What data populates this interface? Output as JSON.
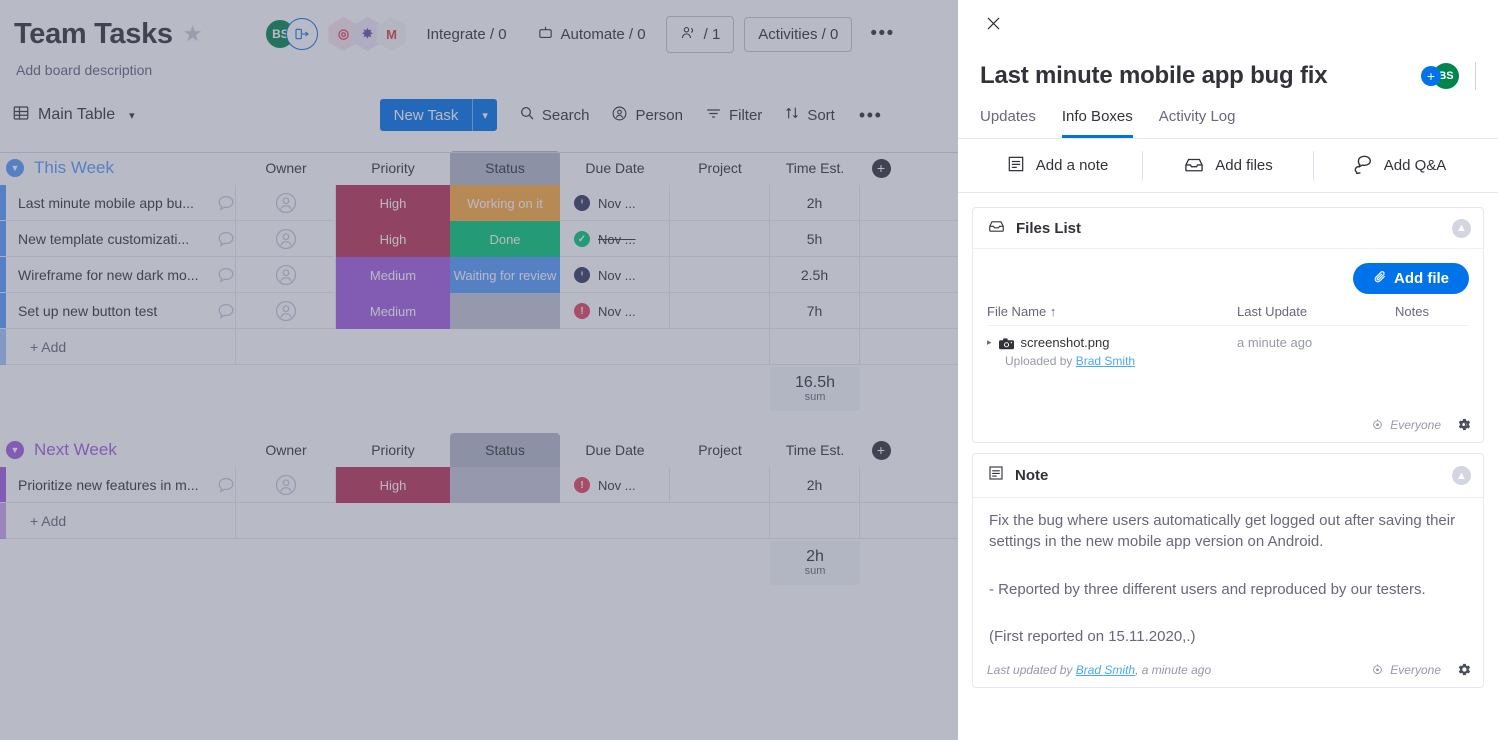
{
  "board": {
    "title": "Team Tasks",
    "description": "Add board description",
    "star_icon": "star-icon",
    "avatar_initials": "BS",
    "integrations": [
      {
        "icon": "dashboard-hex-icon",
        "glyph": "⊞"
      },
      {
        "icon": "slack-hex-icon",
        "glyph": "✸"
      },
      {
        "icon": "gmail-hex-icon",
        "glyph": "M"
      }
    ],
    "header_buttons": [
      {
        "label": "Integrate / 0",
        "icon": "integrate-icon",
        "boxed": false
      },
      {
        "label": "Automate / 0",
        "icon": "robot-icon",
        "boxed": false
      },
      {
        "label": "/ 1",
        "icon": "people-icon",
        "boxed": true
      },
      {
        "label": "Activities / 0",
        "icon": "",
        "boxed": true
      }
    ],
    "more_label": "•••",
    "toolbar": {
      "view_label": "Main Table",
      "view_icon": "table-icon",
      "chevron": "⌄",
      "new_task_label": "New Task",
      "new_task_chevron": "⌄",
      "search_label": "Search",
      "person_label": "Person",
      "filter_label": "Filter",
      "sort_label": "Sort",
      "more_label": "•••"
    },
    "columns": [
      "Owner",
      "Priority",
      "Status",
      "Due Date",
      "Project",
      "Time Est."
    ],
    "add_row_label": "+ Add",
    "sum_label": "sum",
    "groups": [
      {
        "name": "This Week",
        "color": "#579bfc",
        "sum": "16.5h",
        "rows": [
          {
            "name": "Last minute mobile app bu...",
            "priority": "High",
            "priority_color": "#a25ddc",
            "priority_bg": "#bb3354",
            "status": "Working on it",
            "status_bg": "#fdab3d",
            "due": "Nov ...",
            "due_state": "pending",
            "due_color": "#323338",
            "time": "2h",
            "project": ""
          },
          {
            "name": "New template customizati...",
            "priority": "High",
            "priority_bg": "#bb3354",
            "status": "Done",
            "status_bg": "#00c875",
            "due": "Nov ...",
            "due_state": "done",
            "due_color": "#00c875",
            "time": "5h",
            "project": ""
          },
          {
            "name": "Wireframe for new dark mo...",
            "priority": "Medium",
            "priority_bg": "#a25ddc",
            "status": "Waiting for review",
            "status_bg": "#579bfc",
            "due": "Nov ...",
            "due_state": "pending",
            "due_color": "#323338",
            "time": "2.5h",
            "project": ""
          },
          {
            "name": "Set up new button test",
            "priority": "Medium",
            "priority_bg": "#a25ddc",
            "status": "",
            "status_bg": "#c4c7d4",
            "due": "Nov ...",
            "due_state": "overdue",
            "due_color": "#e2445c",
            "time": "7h",
            "project": ""
          }
        ]
      },
      {
        "name": "Next Week",
        "color": "#a25ddc",
        "sum": "2h",
        "rows": [
          {
            "name": "Prioritize new features in m...",
            "priority": "High",
            "priority_bg": "#bb3354",
            "status": "",
            "status_bg": "#c4c7d4",
            "due": "Nov ...",
            "due_state": "overdue",
            "due_color": "#e2445c",
            "time": "2h",
            "project": ""
          }
        ]
      }
    ]
  },
  "panel": {
    "close_icon": "close-icon",
    "title": "Last minute mobile app bug fix",
    "avatar_initials": "BS",
    "add_person_icon": "add-person-icon",
    "tabs": [
      {
        "label": "Updates",
        "active": false
      },
      {
        "label": "Info Boxes",
        "active": true
      },
      {
        "label": "Activity Log",
        "active": false
      }
    ],
    "actions": [
      {
        "label": "Add a note",
        "icon": "note-icon"
      },
      {
        "label": "Add files",
        "icon": "inbox-icon"
      },
      {
        "label": "Add Q&A",
        "icon": "qa-bubble-icon"
      }
    ],
    "files_box": {
      "title": "Files List",
      "icon": "inbox-icon",
      "collapse_icon": "collapse-up-icon",
      "add_file_label": "Add file",
      "add_file_icon": "paperclip-icon",
      "headers": [
        "File Name ↑",
        "Last Update",
        "Notes"
      ],
      "files": [
        {
          "name": "screenshot.png",
          "icon": "camera-icon",
          "caret": "▸",
          "last_update": "a minute ago",
          "uploaded_prefix": "Uploaded by ",
          "uploaded_by": "Brad Smith",
          "notes": ""
        }
      ],
      "visibility": "Everyone",
      "visibility_icon": "eye-icon",
      "settings_icon": "gear-icon"
    },
    "note_box": {
      "title": "Note",
      "icon": "note-icon",
      "collapse_icon": "collapse-up-icon",
      "paragraphs": [
        "Fix the bug where users automatically get logged out after saving their settings in the new mobile app version on Android.",
        "- Reported by three different users and reproduced by our testers.",
        "(First reported on 15.11.2020,.)"
      ],
      "footer_prefix": "Last updated by ",
      "footer_author": "Brad Smith",
      "footer_suffix": ", a minute ago",
      "visibility": "Everyone",
      "visibility_icon": "eye-icon",
      "settings_icon": "gear-icon"
    }
  }
}
